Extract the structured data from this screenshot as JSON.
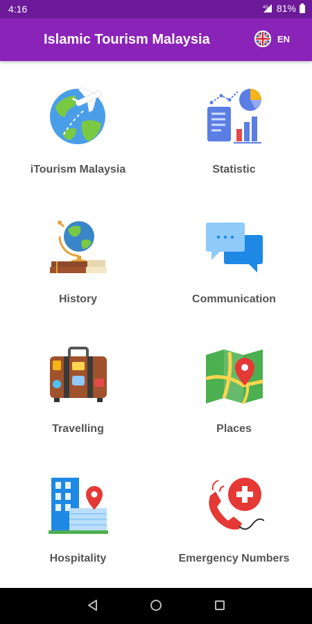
{
  "status": {
    "time": "4:16",
    "battery": "81%"
  },
  "appbar": {
    "title": "Islamic Tourism Malaysia",
    "language": "EN",
    "flag_icon": "uk-flag-icon"
  },
  "menu": [
    {
      "label": "iTourism Malaysia",
      "icon": "globe-airplane-icon"
    },
    {
      "label": "Statistic",
      "icon": "statistics-chart-icon"
    },
    {
      "label": "History",
      "icon": "globe-books-icon"
    },
    {
      "label": "Communication",
      "icon": "chat-bubbles-icon"
    },
    {
      "label": "Travelling",
      "icon": "suitcase-icon"
    },
    {
      "label": "Places",
      "icon": "map-pin-icon"
    },
    {
      "label": "Hospitality",
      "icon": "hotel-building-icon"
    },
    {
      "label": "Emergency Numbers",
      "icon": "emergency-phone-icon"
    }
  ],
  "colors": {
    "statusbar": "#6c1a99",
    "appbar": "#8a23b8",
    "label": "#555555",
    "navbar": "#000000"
  }
}
